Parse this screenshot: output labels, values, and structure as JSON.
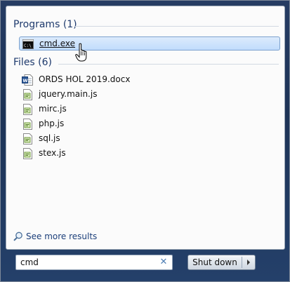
{
  "start_menu": {
    "programs_heading": "Programs (1)",
    "files_heading": "Files (6)",
    "programs": [
      {
        "label": "cmd.exe",
        "icon": "cmd-console-icon"
      }
    ],
    "files": [
      {
        "label": "ORDS HOL 2019.docx",
        "icon": "word-document-icon"
      },
      {
        "label": "jquery.main.js",
        "icon": "script-file-icon"
      },
      {
        "label": "mirc.js",
        "icon": "script-file-icon"
      },
      {
        "label": "php.js",
        "icon": "script-file-icon"
      },
      {
        "label": "sql.js",
        "icon": "script-file-icon"
      },
      {
        "label": "stex.js",
        "icon": "script-file-icon"
      }
    ],
    "see_more": "See more results",
    "search": {
      "value": "cmd"
    },
    "shutdown_label": "Shut down",
    "colors": {
      "accent": "#1e3a6d",
      "selection": "#c1dcfc",
      "frame": "#1d3356"
    }
  }
}
